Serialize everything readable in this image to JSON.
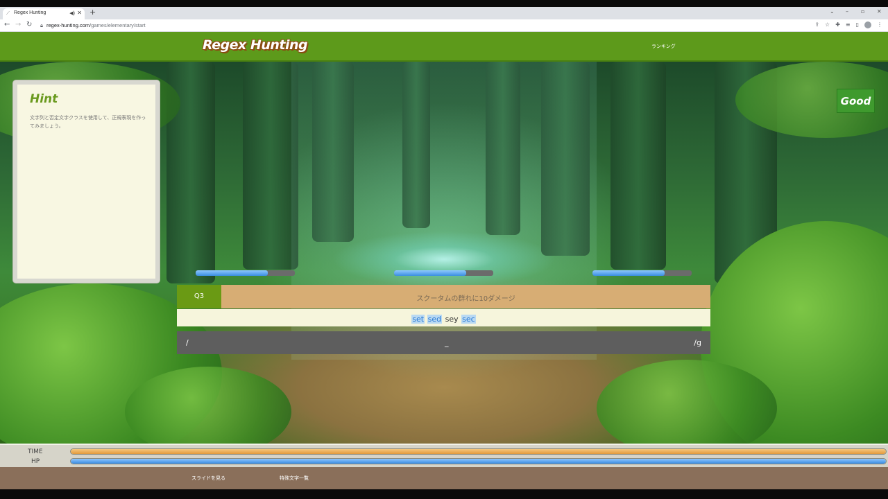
{
  "browser": {
    "tab_title": "Regex Hunting",
    "url_host": "regex-hunting.com",
    "url_path": "/games/elementary/start"
  },
  "header": {
    "logo": "Regex Hunting",
    "nav_ranking": "ランキング"
  },
  "hint": {
    "title": "Hint",
    "text": "文字列と否定文字クラスを使用して、正規表現を作ってみましょう。"
  },
  "badge": {
    "label": "Good"
  },
  "monsters": [
    {
      "hp_fraction": 0.73
    },
    {
      "hp_fraction": 0.73
    },
    {
      "hp_fraction": 0.73
    }
  ],
  "question": {
    "number": "Q3",
    "description": "スクータムの群れに10ダメージ",
    "target_words": [
      {
        "text": "set",
        "match": true
      },
      {
        "text": "sed",
        "match": true
      },
      {
        "text": "sey",
        "match": false
      },
      {
        "text": "sec",
        "match": true
      }
    ]
  },
  "answer": {
    "open_delim": "/",
    "caret": "_",
    "close_delim": "/g"
  },
  "status": {
    "time_label": "TIME",
    "time_fraction": 1.0,
    "hp_label": "HP",
    "hp_fraction": 1.0
  },
  "footer": {
    "slides_link": "スライドを見る",
    "special_chars_link": "特殊文字一覧"
  },
  "colors": {
    "header_green": "#5d9a1b",
    "question_green": "#6a9a14",
    "good_green": "#3f9a2e",
    "match_highlight": "#b9d9f2",
    "hp_blue": "#3b8ce0",
    "time_orange": "#e39a3c"
  }
}
